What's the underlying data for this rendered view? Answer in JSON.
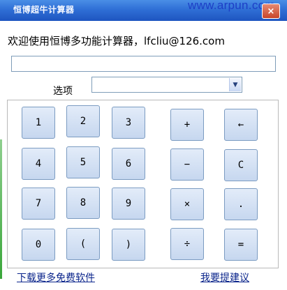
{
  "window": {
    "title": "恒博超牛计算器",
    "watermark": "www.arpun.com",
    "close_label": "×"
  },
  "main": {
    "welcome": "欢迎使用恒博多功能计算器，lfcliu@126.com",
    "display_value": "",
    "option_label": "选项",
    "option_selected": "",
    "option_arrow": "▼"
  },
  "keys": [
    {
      "name": "key-1",
      "label": "1"
    },
    {
      "name": "key-2",
      "label": "2"
    },
    {
      "name": "key-3",
      "label": "3"
    },
    {
      "name": "key-plus",
      "label": "+"
    },
    {
      "name": "key-backspace",
      "label": "←"
    },
    {
      "name": "key-4",
      "label": "4"
    },
    {
      "name": "key-5",
      "label": "5"
    },
    {
      "name": "key-6",
      "label": "6"
    },
    {
      "name": "key-minus",
      "label": "−"
    },
    {
      "name": "key-clear",
      "label": "C"
    },
    {
      "name": "key-7",
      "label": "7"
    },
    {
      "name": "key-8",
      "label": "8"
    },
    {
      "name": "key-9",
      "label": "9"
    },
    {
      "name": "key-multiply",
      "label": "×"
    },
    {
      "name": "key-decimal",
      "label": "."
    },
    {
      "name": "key-0",
      "label": "0"
    },
    {
      "name": "key-left-paren",
      "label": "("
    },
    {
      "name": "key-right-paren",
      "label": ")"
    },
    {
      "name": "key-divide",
      "label": "÷"
    },
    {
      "name": "key-equals",
      "label": "="
    }
  ],
  "footer": {
    "download_link": "下载更多免费软件",
    "feedback_link": "我要提建议"
  }
}
